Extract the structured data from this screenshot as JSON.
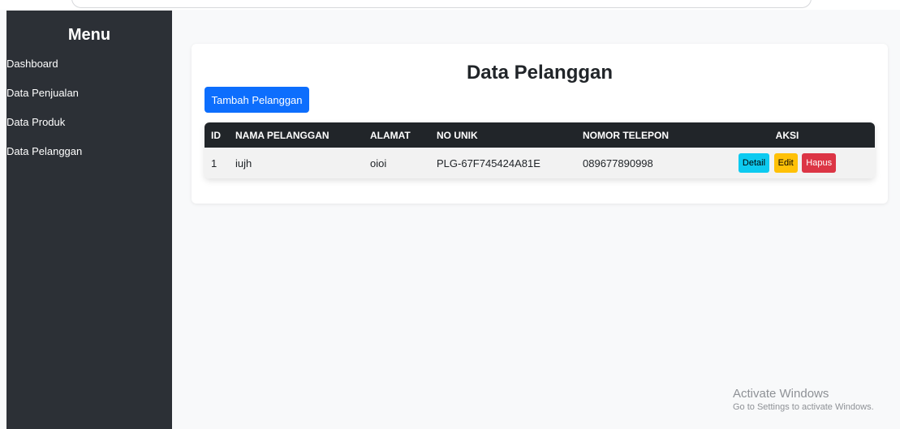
{
  "sidebar": {
    "title": "Menu",
    "items": [
      {
        "label": "Dashboard"
      },
      {
        "label": "Data Penjualan"
      },
      {
        "label": "Data Produk"
      },
      {
        "label": "Data Pelanggan"
      }
    ]
  },
  "main": {
    "title": "Data Pelanggan",
    "add_button": "Tambah Pelanggan",
    "table": {
      "headers": [
        "ID",
        "NAMA PELANGGAN",
        "ALAMAT",
        "NO UNIK",
        "NOMOR TELEPON",
        "AKSI"
      ],
      "rows": [
        {
          "id": "1",
          "nama": "iujh",
          "alamat": "oioi",
          "no_unik": "PLG-67F745424A81E",
          "telepon": "089677890998",
          "actions": {
            "detail": "Detail",
            "edit": "Edit",
            "hapus": "Hapus"
          }
        }
      ]
    }
  },
  "watermark": {
    "title": "Activate Windows",
    "subtitle": "Go to Settings to activate Windows."
  },
  "colors": {
    "sidebar_bg": "#2c3036",
    "primary": "#0d6efd",
    "info": "#0dcaf0",
    "warning": "#ffc107",
    "danger": "#dc3545",
    "table_header": "#212529"
  }
}
